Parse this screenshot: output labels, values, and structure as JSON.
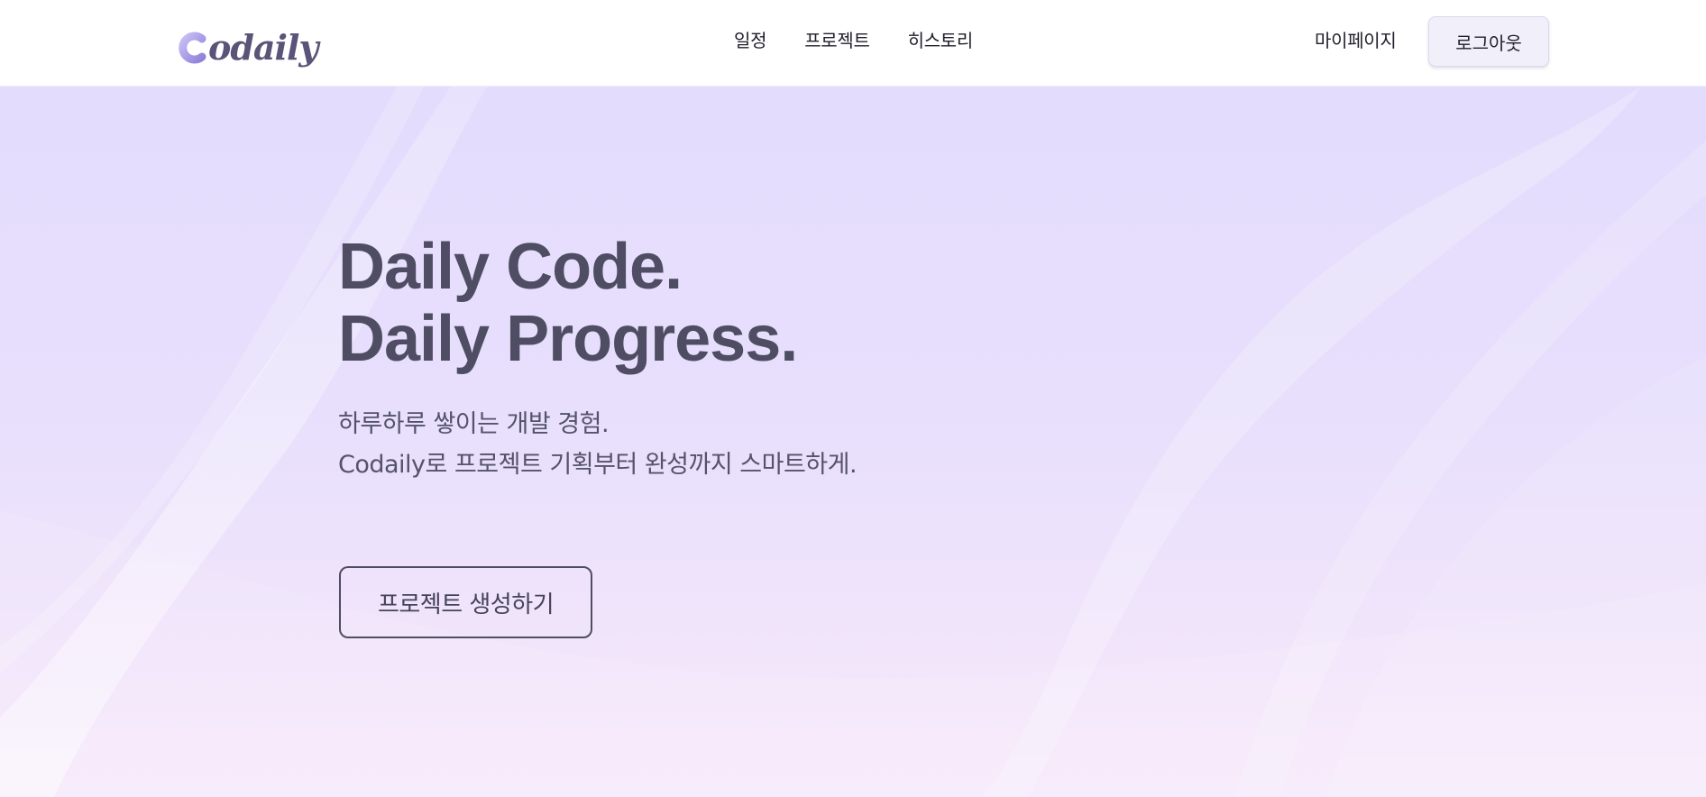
{
  "header": {
    "logo_text": "odaily",
    "logo_initial": "C",
    "nav": [
      {
        "label": "일정"
      },
      {
        "label": "프로젝트"
      },
      {
        "label": "히스토리"
      }
    ],
    "mypage_label": "마이페이지",
    "logout_label": "로그아웃"
  },
  "hero": {
    "title_line1": "Daily Code.",
    "title_line2": "Daily Progress.",
    "desc_line1": "하루하루 쌓이는 개발 경험.",
    "desc_line2": "Codaily로 프로젝트 기획부터 완성까지 스마트하게.",
    "cta_label": "프로젝트 생성하기"
  },
  "colors": {
    "accent": "#4f4d63",
    "hero_bg_top": "#e4dcfd",
    "hero_bg_bottom": "#f7eafb",
    "logo_purple": "#9b8fe0",
    "logout_bg": "#f1effa"
  }
}
